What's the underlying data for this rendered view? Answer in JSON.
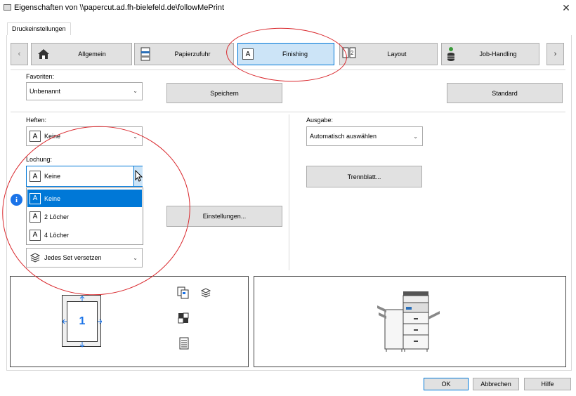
{
  "window": {
    "title": "Eigenschaften von \\\\papercut.ad.fh-bielefeld.de\\followMePrint"
  },
  "tabs": [
    {
      "label": "Druckeinstellungen"
    }
  ],
  "nav": {
    "items": [
      {
        "label": "Allgemein",
        "icon": "home-icon"
      },
      {
        "label": "Papierzufuhr",
        "icon": "paper-tray-icon"
      },
      {
        "label": "Finishing",
        "icon": "finishing-icon"
      },
      {
        "label": "Layout",
        "icon": "layout-icon"
      },
      {
        "label": "Job-Handling",
        "icon": "job-handling-icon"
      }
    ],
    "active": "Finishing"
  },
  "favorites": {
    "label": "Favoriten:",
    "value": "Unbenannt",
    "save": "Speichern",
    "standard": "Standard"
  },
  "heften": {
    "label": "Heften:",
    "value": "Keine"
  },
  "lochung": {
    "label": "Lochung:",
    "value": "Keine",
    "options": [
      "Keine",
      "2 Löcher",
      "4 Löcher"
    ]
  },
  "einstellungen": {
    "label": "Einstellungen..."
  },
  "versetzen": {
    "value": "Jedes Set versetzen"
  },
  "ausgabe": {
    "label": "Ausgabe:",
    "value": "Automatisch auswählen",
    "trennblatt": "Trennblatt..."
  },
  "preview": {
    "page_number": "1"
  },
  "footer": {
    "ok": "OK",
    "cancel": "Abbrechen",
    "help": "Hilfe"
  },
  "colors": {
    "accent": "#0078d7",
    "annotation": "#d9262b",
    "info": "#1a73e8"
  }
}
